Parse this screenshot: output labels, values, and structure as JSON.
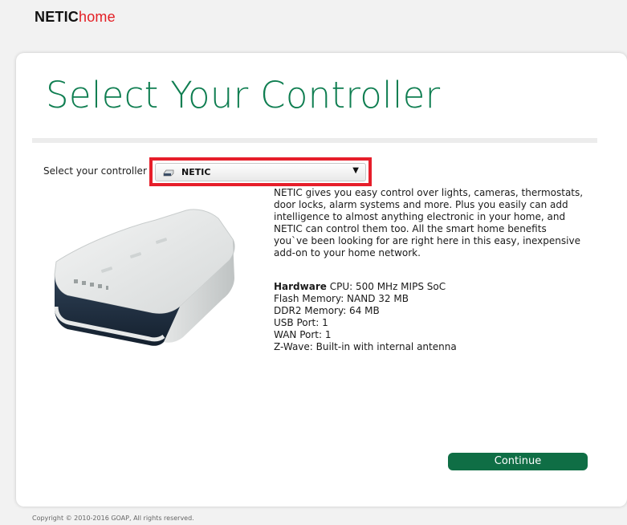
{
  "header": {
    "logo_part1": "NETIC",
    "logo_part2": "home"
  },
  "page": {
    "title": "Select Your Controller"
  },
  "controller_select": {
    "label": "Select your controller",
    "selected_value": "NETIC",
    "icon": "router-device-icon"
  },
  "description": "NETIC gives you easy control over lights, cameras, thermostats, door locks, alarm systems and more. Plus you easily can add intelligence to almost anything electronic in your home, and NETIC can control them too. All the smart home benefits you`ve been looking for are right here in this easy, inexpensive add-on to your home network.",
  "specs": {
    "hardware_label": "Hardware",
    "cpu": "CPU: 500 MHz MIPS SoC",
    "flash": "Flash Memory: NAND 32 MB",
    "ddr2": "DDR2 Memory: 64 MB",
    "usb": "USB Port: 1",
    "wan": "WAN Port: 1",
    "zwave": "Z-Wave: Built-in with internal antenna"
  },
  "buttons": {
    "continue_label": "Continue"
  },
  "footer": {
    "copyright": "Copyright © 2010-2016 GOAP, All rights reserved."
  },
  "colors": {
    "brand_green": "#0f7e51",
    "button_green": "#0f6e45",
    "logo_red": "#e31e24",
    "highlight_red": "#e61e2a"
  }
}
